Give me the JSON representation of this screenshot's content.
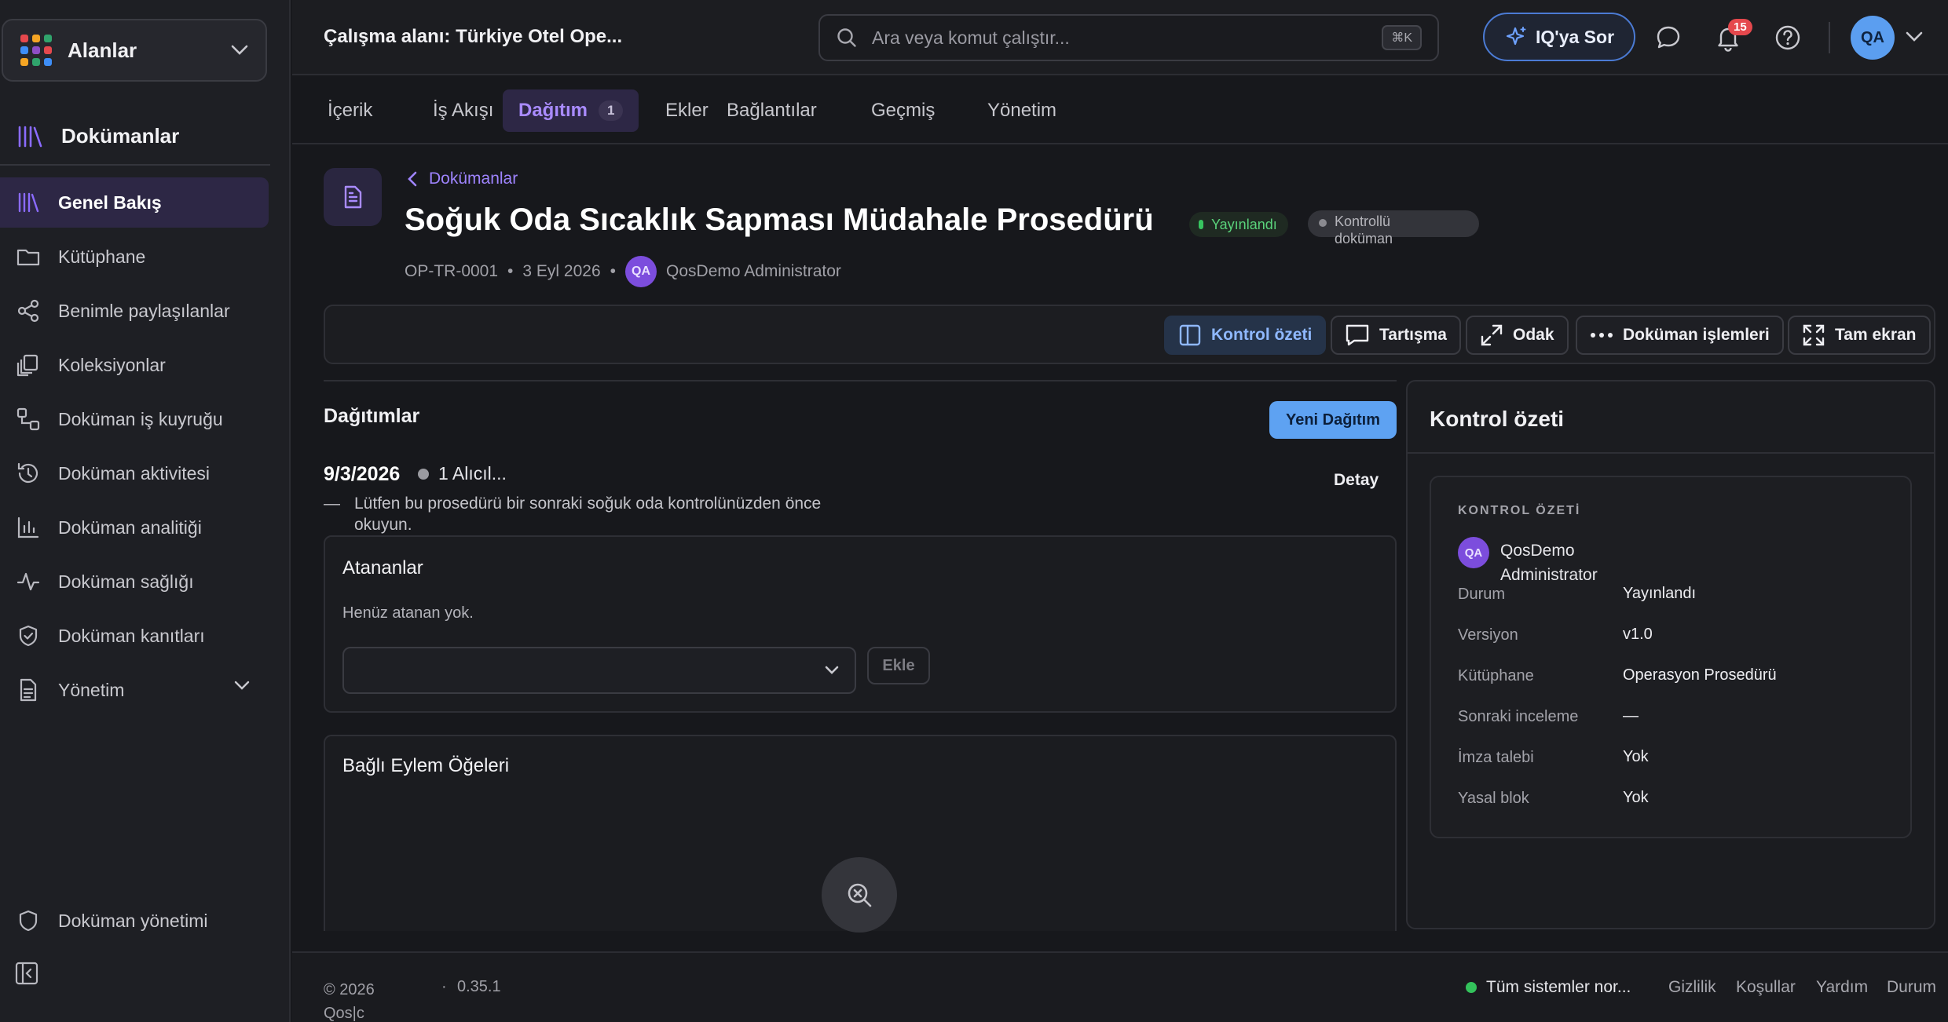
{
  "sidebar": {
    "space_label": "Alanlar",
    "space_colors": [
      "#e5484d",
      "#f5a524",
      "#30a46c",
      "#3e8ef7",
      "#8e4ec6",
      "#e5484d",
      "#f5a524",
      "#30a46c",
      "#3e8ef7"
    ],
    "section_title": "Dokümanlar",
    "items": [
      {
        "label": "Genel Bakış",
        "icon": "library-icon",
        "active": true
      },
      {
        "label": "Kütüphane",
        "icon": "folder-icon"
      },
      {
        "label": "Benimle paylaşılanlar",
        "icon": "share-icon"
      },
      {
        "label": "Koleksiyonlar",
        "icon": "collections-icon"
      },
      {
        "label": "Doküman iş kuyruğu",
        "icon": "workflow-icon"
      },
      {
        "label": "Doküman aktivitesi",
        "icon": "history-icon"
      },
      {
        "label": "Doküman analitiği",
        "icon": "bar-chart-icon"
      },
      {
        "label": "Doküman sağlığı",
        "icon": "pulse-icon"
      },
      {
        "label": "Doküman kanıtları",
        "icon": "shield-check-icon"
      },
      {
        "label": "Yönetim",
        "icon": "document-icon"
      }
    ],
    "bottom_item": "Doküman yönetimi"
  },
  "topbar": {
    "workspace": "Çalışma alanı: Türkiye Otel Ope...",
    "search_placeholder": "Ara veya komut çalıştır...",
    "shortcut": "⌘K",
    "ask_label": "IQ'ya Sor",
    "notification_count": "15",
    "avatar_initials": "QA",
    "accent": "#5ea2f2"
  },
  "tabs": [
    {
      "label": "İçerik"
    },
    {
      "label": "İş Akışı"
    },
    {
      "label": "Dağıtım",
      "count": "1",
      "active": true
    },
    {
      "label": "Ekler"
    },
    {
      "label": "Bağlantılar"
    },
    {
      "label": "Geçmiş"
    },
    {
      "label": "Yönetim"
    }
  ],
  "header": {
    "breadcrumb": "Dokümanlar",
    "title": "Soğuk Oda Sıcaklık Sapması Müdahale Prosedürü",
    "status_badge": "Yayınlandı",
    "control_badge": "Kontrollü doküman",
    "doc_code": "OP-TR-0001",
    "date": "3 Eyl 2026",
    "author_initials": "QA",
    "author": "QosDemo Administrator",
    "separator": "•"
  },
  "toolbar": {
    "control_summary": "Kontrol özeti",
    "discussion": "Tartışma",
    "focus": "Odak",
    "doc_actions": "Doküman işlemleri",
    "fullscreen": "Tam ekran"
  },
  "distributions": {
    "title": "Dağıtımlar",
    "new_button": "Yeni Dağıtım",
    "item": {
      "date": "9/3/2026",
      "recipients": "1 Alıcıl...",
      "detail": "Detay",
      "dash": "—",
      "note": "Lütfen bu prosedürü bir sonraki soğuk oda kontrolünüzden önce okuyun."
    },
    "assignees": {
      "title": "Atananlar",
      "empty": "Henüz atanan yok.",
      "add_button": "Ekle"
    },
    "linked_actions": {
      "title": "Bağlı Eylem Öğeleri"
    }
  },
  "panel": {
    "title": "Kontrol özeti",
    "label": "KONTROL ÖZETİ",
    "owner_initials": "QA",
    "owner": "QosDemo Administrator",
    "rows": [
      {
        "k": "Durum",
        "v": "Yayınlandı"
      },
      {
        "k": "Versiyon",
        "v": "v1.0"
      },
      {
        "k": "Kütüphane",
        "v": "Operasyon Prosedürü"
      },
      {
        "k": "Sonraki inceleme",
        "v": "—"
      },
      {
        "k": "İmza talebi",
        "v": "Yok"
      },
      {
        "k": "Yasal blok",
        "v": "Yok"
      }
    ]
  },
  "footer": {
    "copyright": "© 2026 Qos|c",
    "version_dot": "·",
    "version": "0.35.1",
    "status": "Tüm sistemler nor...",
    "links": [
      "Gizlilik",
      "Koşullar",
      "Yardım",
      "Durum"
    ]
  }
}
